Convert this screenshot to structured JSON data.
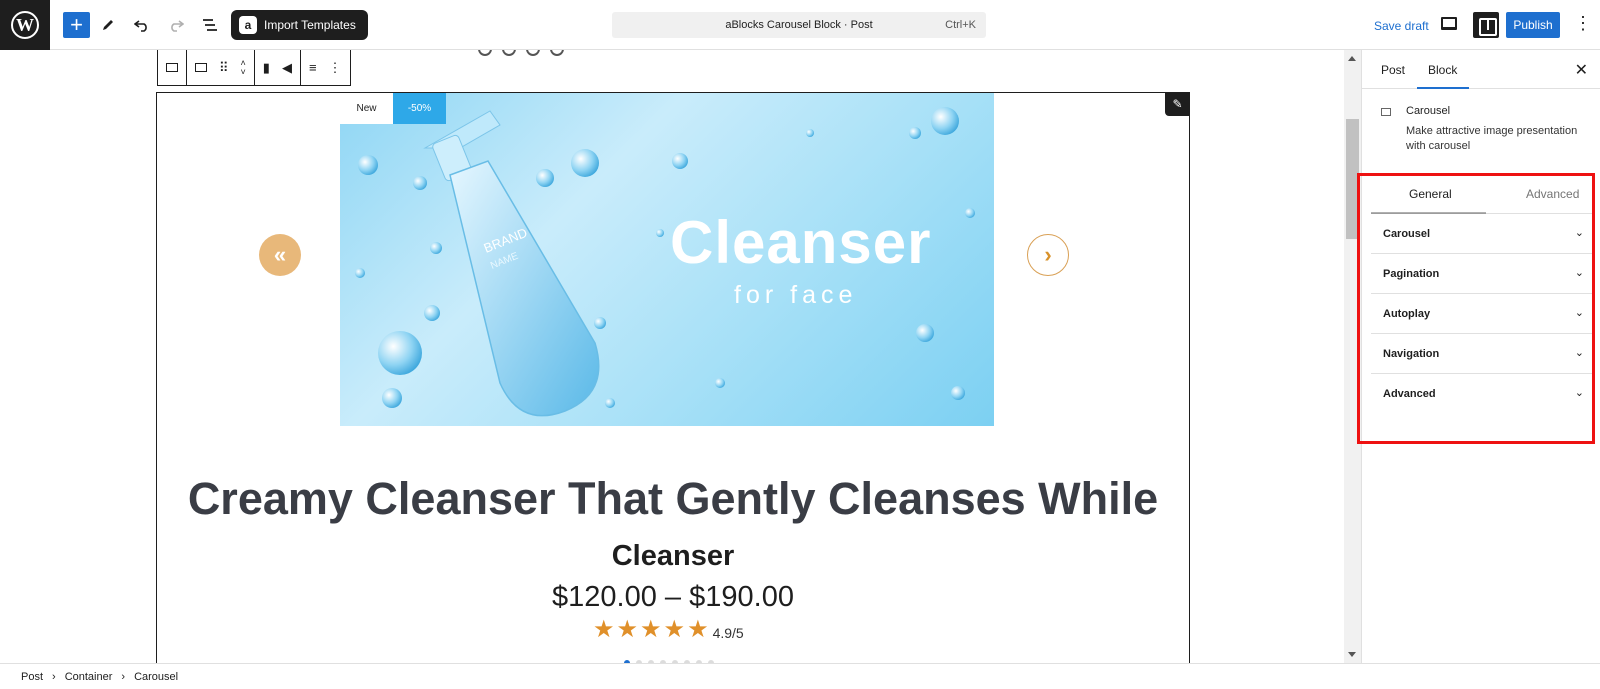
{
  "topbar": {
    "import_label": "Import Templates",
    "command_title": "aBlocks Carousel Block · Post",
    "command_shortcut": "Ctrl+K",
    "save_draft": "Save draft",
    "publish": "Publish",
    "icons": [
      "wordpress-logo",
      "plus-icon",
      "pen-icon",
      "undo-icon",
      "redo-icon",
      "list-view-icon",
      "preview-icon",
      "settings-icon",
      "more-vertical-icon"
    ]
  },
  "carousel": {
    "badge_new": "New",
    "badge_sale": "-50%",
    "image_headline": "Cleanser",
    "image_sub": "for face",
    "bottle_label_1": "BRAND",
    "bottle_label_2": "NAME",
    "heading": "Creamy Cleanser That Gently Cleanses While",
    "subheading": "Cleanser",
    "price": "$120.00 – $190.00",
    "rating_value": 5,
    "rating_text": "4.9/5",
    "slide_count": 8,
    "active_slide": 1,
    "colors": {
      "accent_orange": "#e0902a",
      "sale_blue": "#2ea8e8"
    }
  },
  "breadcrumb": [
    "Post",
    "Container",
    "Carousel"
  ],
  "sidebar": {
    "tabs": [
      "Post",
      "Block"
    ],
    "active_tab": "Block",
    "block_name": "Carousel",
    "block_description": "Make attractive image presentation with carousel",
    "panel_tabs": [
      "General",
      "Advanced"
    ],
    "active_panel_tab": "General",
    "sections": [
      "Carousel",
      "Pagination",
      "Autoplay",
      "Navigation",
      "Advanced"
    ]
  }
}
